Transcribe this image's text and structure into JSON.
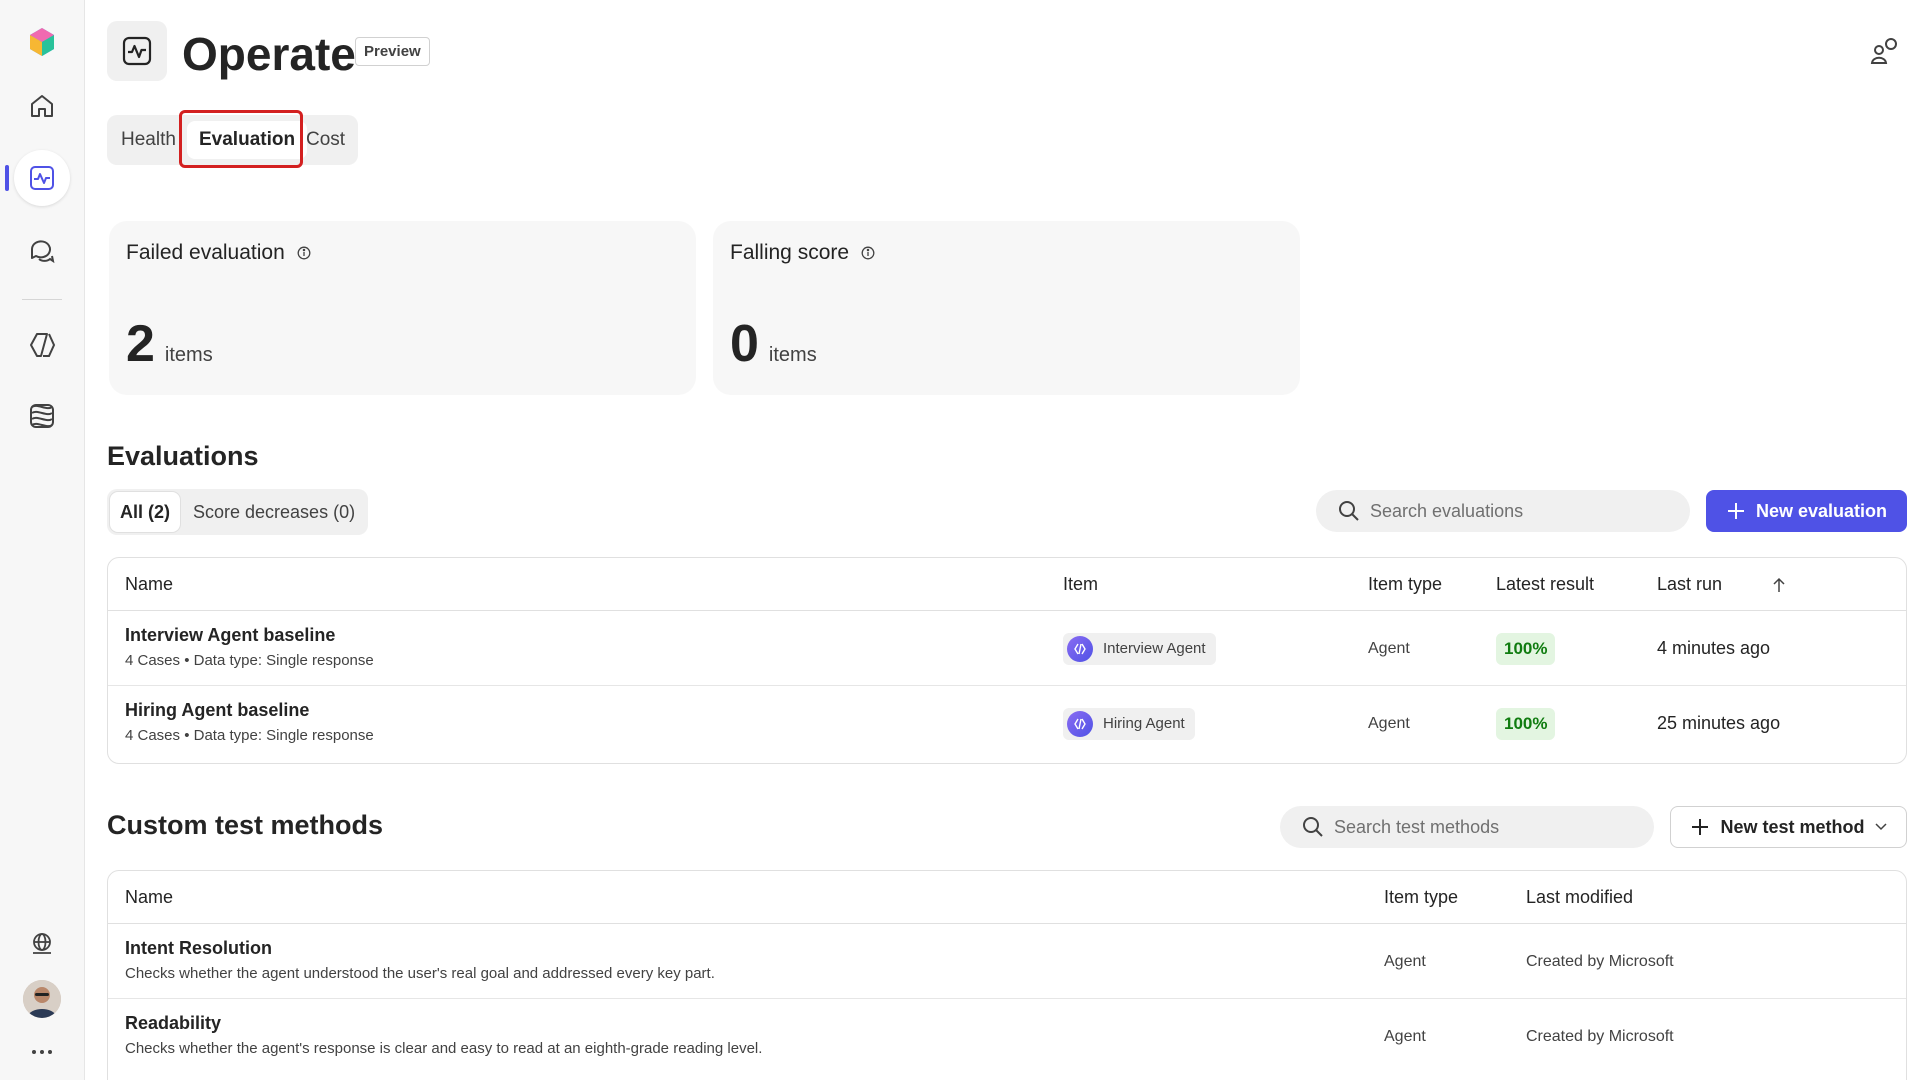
{
  "header": {
    "title": "Operate",
    "badge": "Preview"
  },
  "tabs": [
    {
      "label": "Health"
    },
    {
      "label": "Evaluation",
      "selected": true
    },
    {
      "label": "Cost"
    }
  ],
  "cards": [
    {
      "title": "Failed evaluation",
      "value": "2",
      "unit": "items"
    },
    {
      "title": "Falling score",
      "value": "0",
      "unit": "items"
    }
  ],
  "evaluations": {
    "title": "Evaluations",
    "filters": [
      {
        "label": "All (2)",
        "selected": true
      },
      {
        "label": "Score decreases (0)"
      }
    ],
    "search_placeholder": "Search evaluations",
    "new_button": "New evaluation",
    "columns": [
      "Name",
      "Item",
      "Item type",
      "Latest result",
      "Last run"
    ],
    "rows": [
      {
        "name": "Interview Agent baseline",
        "sub": "4 Cases • Data type: Single response",
        "item": "Interview Agent",
        "item_type": "Agent",
        "result": "100%",
        "last_run": "4 minutes ago"
      },
      {
        "name": "Hiring Agent baseline",
        "sub": "4 Cases • Data type: Single response",
        "item": "Hiring Agent",
        "item_type": "Agent",
        "result": "100%",
        "last_run": "25 minutes ago"
      }
    ]
  },
  "custom_methods": {
    "title": "Custom test methods",
    "search_placeholder": "Search test methods",
    "new_button": "New test method",
    "columns": [
      "Name",
      "Item type",
      "Last modified"
    ],
    "rows": [
      {
        "name": "Intent Resolution",
        "sub": "Checks whether the agent understood the user's real goal and addressed every key part.",
        "item_type": "Agent",
        "modified": "Created by Microsoft"
      },
      {
        "name": "Readability",
        "sub": "Checks whether the agent's response is clear and easy to read at an eighth-grade reading level.",
        "item_type": "Agent",
        "modified": "Created by Microsoft"
      }
    ]
  },
  "colors": {
    "accent": "#4f52e6",
    "highlight": "#d32020",
    "success_bg": "#e3f5e1",
    "success_text": "#107c10"
  },
  "icons": {
    "rail": [
      "app-logo-icon",
      "home-icon",
      "operate-icon",
      "chat-icon",
      "agent-icon",
      "model-icon",
      "globe-icon",
      "more-icon"
    ],
    "top_right": "feedback-icon"
  }
}
